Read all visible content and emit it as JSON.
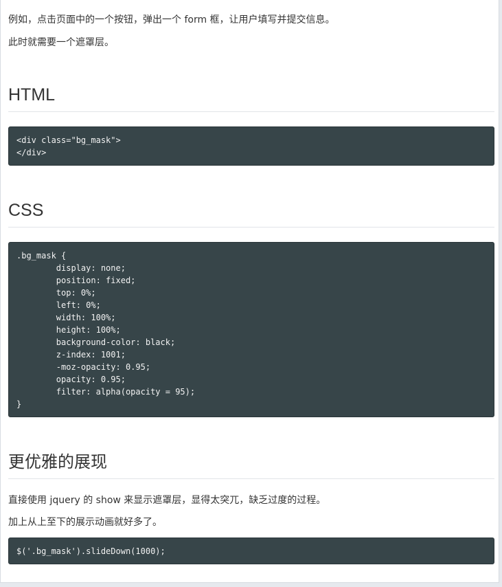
{
  "intro": {
    "p1": "例如，点击页面中的一个按钮，弹出一个 form 框，让用户填写并提交信息。",
    "p2": "此时就需要一个遮罩层。"
  },
  "sections": [
    {
      "heading": "HTML",
      "code": "<div class=\"bg_mask\">\n</div>"
    },
    {
      "heading": "CSS",
      "code": ".bg_mask {\n        display: none;\n        position: fixed;\n        top: 0%;\n        left: 0%;\n        width: 100%;\n        height: 100%;\n        background-color: black;\n        z-index: 1001;\n        -moz-opacity: 0.95;\n        opacity: 0.95;\n        filter: alpha(opacity = 95);\n}"
    },
    {
      "heading": "更优雅的展现",
      "p1": "直接使用 jquery 的 show 来显示遮罩层，显得太突兀，缺乏过度的过程。",
      "p2": "加上从上至下的展示动画就好多了。",
      "code": "$('.bg_mask').slideDown(1000);"
    }
  ]
}
